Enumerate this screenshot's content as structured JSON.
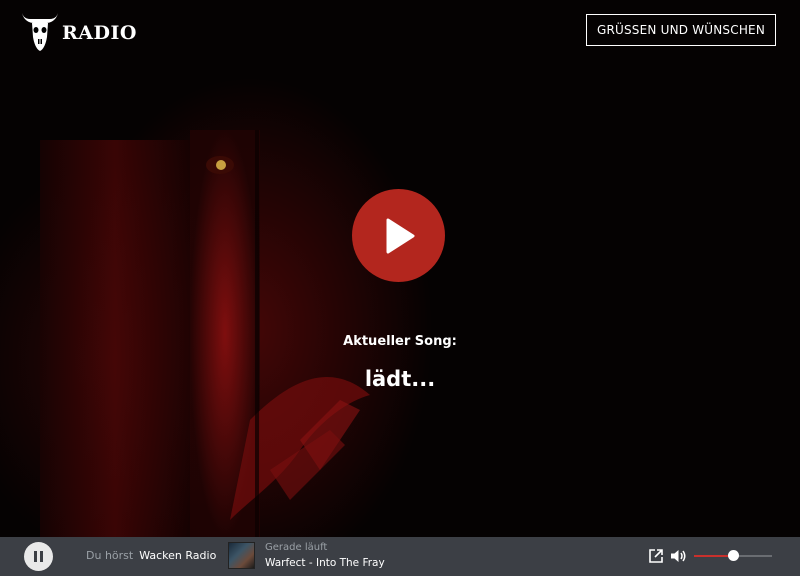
{
  "brand": {
    "logo_text": "RADIO",
    "icon": "bull-skull-icon"
  },
  "header": {
    "greet_button_label": "GRÜSSEN UND WÜNSCHEN"
  },
  "hero": {
    "play_icon": "play-icon",
    "current_song_label": "Aktueller Song:",
    "current_song_value": "lädt..."
  },
  "player": {
    "pause_icon": "pause-icon",
    "listening_label": "Du hörst",
    "station_name": "Wacken Radio",
    "now_playing_label": "Gerade läuft",
    "track": "Warfect - Into The Fray",
    "volume_level": 0.5,
    "colors": {
      "bar_bg": "#3c3f45",
      "accent": "#b3261e"
    }
  }
}
